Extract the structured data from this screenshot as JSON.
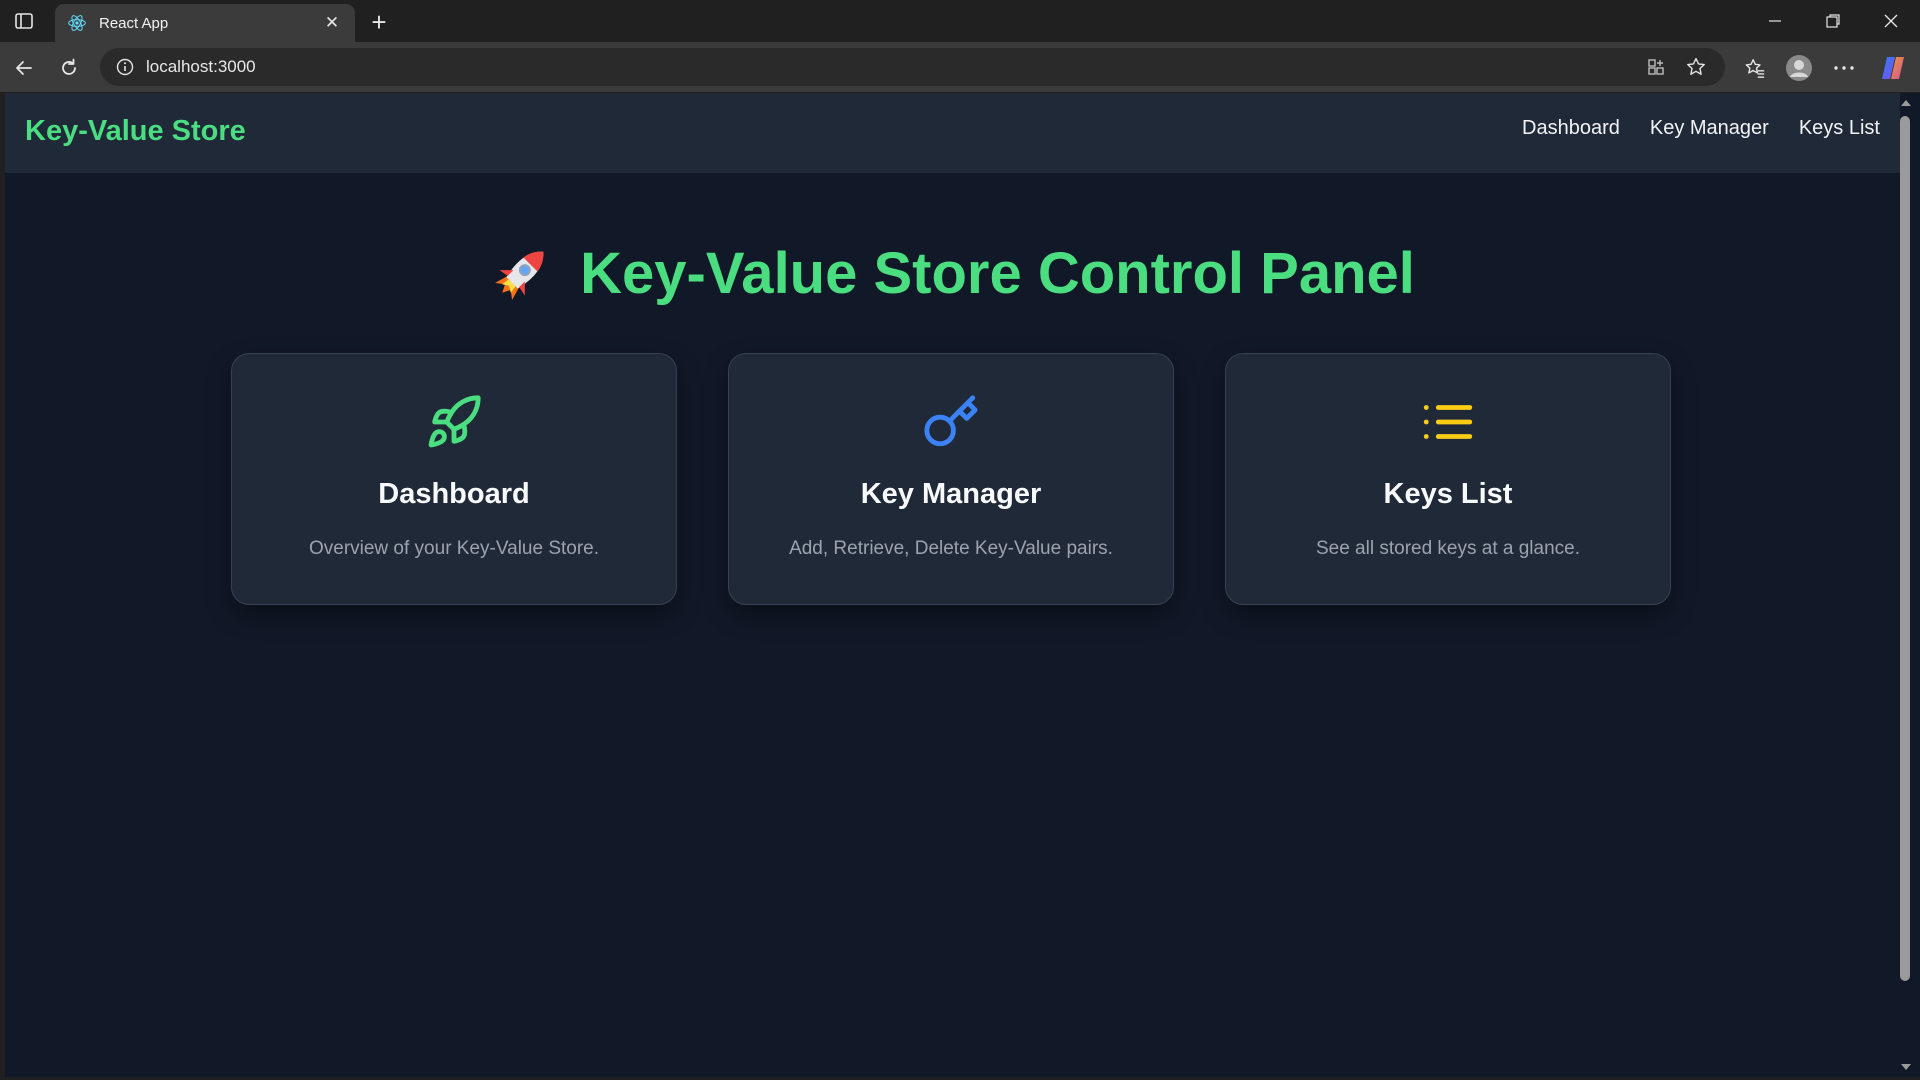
{
  "browser": {
    "tab_title": "React App",
    "address": "localhost:3000"
  },
  "app": {
    "brand": "Key-Value Store",
    "nav": [
      "Dashboard",
      "Key Manager",
      "Keys List"
    ],
    "hero_title": "Key-Value Store Control Panel",
    "cards": [
      {
        "icon": "rocket-icon",
        "title": "Dashboard",
        "description": "Overview of your Key-Value Store."
      },
      {
        "icon": "key-icon",
        "title": "Key Manager",
        "description": "Add, Retrieve, Delete Key-Value pairs."
      },
      {
        "icon": "list-icon",
        "title": "Keys List",
        "description": "See all stored keys at a glance."
      }
    ]
  },
  "colors": {
    "accent_green": "#4ade80",
    "key_blue": "#3b82f6",
    "list_yellow": "#facc15",
    "page_bg": "#111827",
    "card_bg": "#1f2937"
  }
}
